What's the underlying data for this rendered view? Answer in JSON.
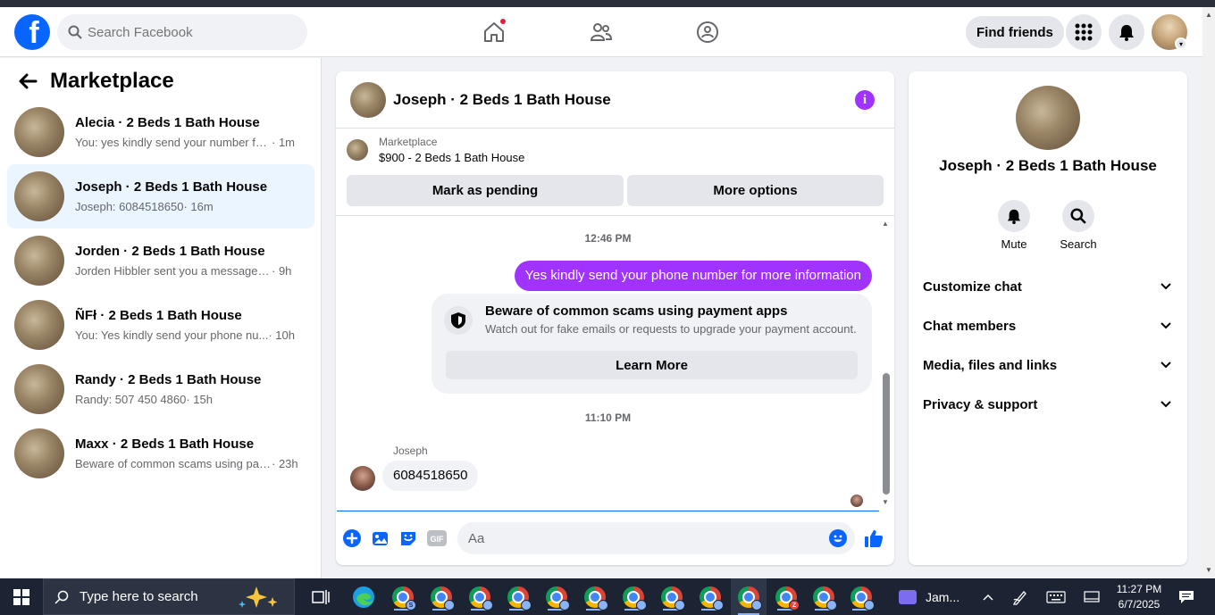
{
  "header": {
    "logo_letter": "f",
    "search_placeholder": "Search Facebook",
    "find_friends_label": "Find friends"
  },
  "left_panel": {
    "title": "Marketplace",
    "conversations": [
      {
        "title": "Alecia · 2 Beds 1 Bath House",
        "preview": "You: yes kindly send your number for...",
        "time": "· 1m",
        "active": false
      },
      {
        "title": "Joseph · 2 Beds 1 Bath House",
        "preview": "Joseph: 6084518650",
        "time": "· 16m",
        "active": true
      },
      {
        "title": "Jorden · 2 Beds 1 Bath House",
        "preview": "Jorden Hibbler sent you a message ab...",
        "time": "· 9h",
        "active": false
      },
      {
        "title": "ÑFł · 2 Beds 1 Bath House",
        "preview": "You: Yes kindly send your phone nu...",
        "time": "· 10h",
        "active": false
      },
      {
        "title": "Randy · 2 Beds 1 Bath House",
        "preview": "Randy: 507 450 4860",
        "time": "· 15h",
        "active": false
      },
      {
        "title": "Maxx · 2 Beds 1 Bath House",
        "preview": "Beware of common scams using pay...",
        "time": "· 23h",
        "active": false
      }
    ]
  },
  "chat": {
    "title": "Joseph · 2 Beds 1 Bath House",
    "listing_source": "Marketplace",
    "listing_price": "$900 - 2 Beds 1 Bath House",
    "mark_pending_label": "Mark as pending",
    "more_options_label": "More options",
    "timestamp_1": "12:46 PM",
    "outgoing_message": "Yes kindly send your phone number for more information",
    "warning_title": "Beware of common scams using payment apps",
    "warning_subtitle": "Watch out for fake emails or requests to upgrade your payment account.",
    "learn_more_label": "Learn More",
    "timestamp_2": "11:10 PM",
    "sender_name": "Joseph",
    "incoming_message": "6084518650",
    "composer_placeholder": "Aa",
    "gif_label": "GIF"
  },
  "right_panel": {
    "name": "Joseph · 2 Beds 1 Bath House",
    "mute_label": "Mute",
    "search_label": "Search",
    "sections": [
      "Customize chat",
      "Chat members",
      "Media, files and links",
      "Privacy & support"
    ]
  },
  "taskbar": {
    "search_placeholder": "Type here to search",
    "meet_label": "Jam...",
    "time": "11:27 PM",
    "date": "6/7/2025",
    "chrome_badges": [
      "S",
      "",
      "",
      "",
      "",
      "",
      "",
      "",
      "",
      "",
      "Z",
      "",
      ""
    ]
  },
  "colors": {
    "facebook_blue": "#0866ff",
    "messenger_purple": "#a033ff",
    "notification_red": "#e41e3f",
    "active_conversation_bg": "#ebf5ff"
  }
}
